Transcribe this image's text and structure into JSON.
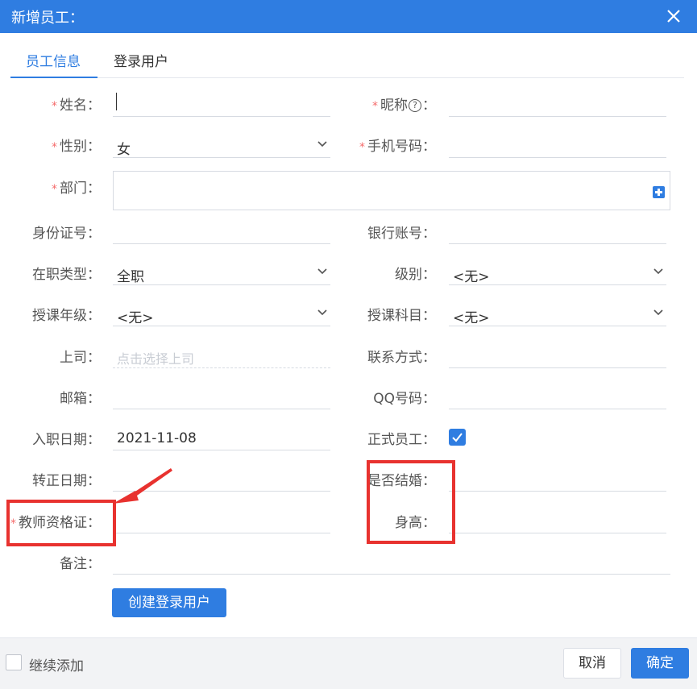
{
  "dialog": {
    "title": "新增员工："
  },
  "tabs": [
    {
      "label": "员工信息"
    },
    {
      "label": "登录用户"
    }
  ],
  "form": {
    "name": {
      "label": "姓名：",
      "value": ""
    },
    "nickname": {
      "label_a": "昵称",
      "label_b": "：",
      "help": "?"
    },
    "gender": {
      "label": "性别：",
      "value": "女"
    },
    "mobile": {
      "label": "手机号码："
    },
    "department": {
      "label": "部门："
    },
    "id_number": {
      "label": "身份证号："
    },
    "bank_account": {
      "label": "银行账号："
    },
    "employment_type": {
      "label": "在职类型：",
      "value": "全职"
    },
    "level": {
      "label": "级别：",
      "value": "<无>"
    },
    "grade": {
      "label": "授课年级：",
      "value": "<无>"
    },
    "subject": {
      "label": "授课科目：",
      "value": "<无>"
    },
    "supervisor": {
      "label": "上司：",
      "placeholder": "点击选择上司"
    },
    "contact": {
      "label": "联系方式："
    },
    "email": {
      "label": "邮箱："
    },
    "qq": {
      "label": "QQ号码："
    },
    "hire_date": {
      "label": "入职日期：",
      "value": "2021-11-08"
    },
    "regular": {
      "label": "正式员工：",
      "checked": true
    },
    "regular_date": {
      "label": "转正日期："
    },
    "married": {
      "label": "是否结婚："
    },
    "teacher_cert": {
      "label": "教师资格证："
    },
    "height": {
      "label": "身高："
    },
    "remarks": {
      "label": "备注："
    },
    "required_mark": "*"
  },
  "buttons": {
    "create_user": "创建登录用户",
    "cancel": "取消",
    "ok": "确定"
  },
  "footer": {
    "continue_add": "继续添加",
    "continue_checked": false
  },
  "colors": {
    "accent": "#2f7de1",
    "required": "#f56c6c",
    "highlight": "#e8322f"
  }
}
